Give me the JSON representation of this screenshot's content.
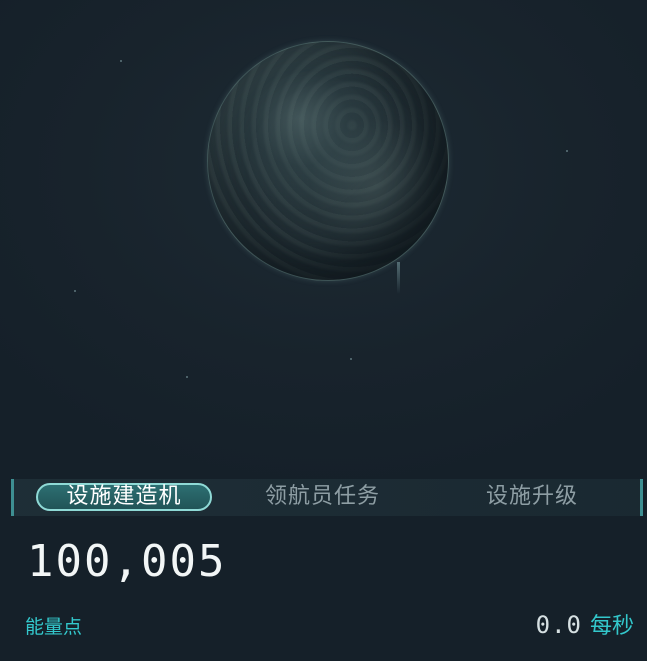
{
  "tabs": [
    {
      "label": "设施建造机",
      "active": true
    },
    {
      "label": "领航员任务",
      "active": false
    },
    {
      "label": "设施升级",
      "active": false
    }
  ],
  "resource": {
    "value": "100,005",
    "label": "能量点",
    "rate_value": "0.0",
    "rate_unit": "每秒"
  },
  "colors": {
    "accent": "#33c8cc",
    "tab_active_bg": "#2d6f72",
    "background": "#18232c"
  }
}
